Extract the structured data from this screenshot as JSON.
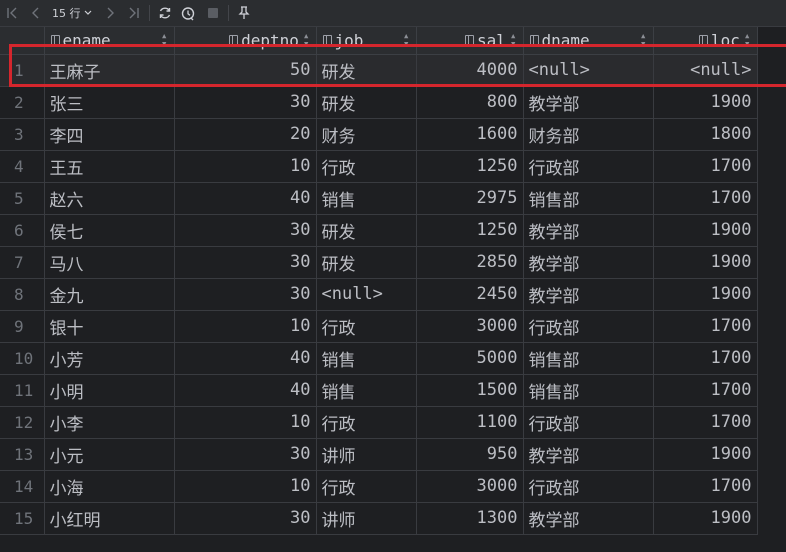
{
  "toolbar": {
    "rows_label": "15 行",
    "icons": [
      "first-page-icon",
      "prev-page-icon",
      "next-page-icon",
      "last-page-icon",
      "refresh-icon",
      "history-icon",
      "stop-icon",
      "pin-icon"
    ]
  },
  "columns": [
    "ename",
    "deptno",
    "job",
    "sal",
    "dname",
    "loc"
  ],
  "rows": [
    {
      "n": "1",
      "ename": "王麻子",
      "deptno": "50",
      "job": "研发",
      "sal": "4000",
      "dname": "<null>",
      "loc": "<null>"
    },
    {
      "n": "2",
      "ename": "张三",
      "deptno": "30",
      "job": "研发",
      "sal": "800",
      "dname": "教学部",
      "loc": "1900"
    },
    {
      "n": "3",
      "ename": "李四",
      "deptno": "20",
      "job": "财务",
      "sal": "1600",
      "dname": "财务部",
      "loc": "1800"
    },
    {
      "n": "4",
      "ename": "王五",
      "deptno": "10",
      "job": "行政",
      "sal": "1250",
      "dname": "行政部",
      "loc": "1700"
    },
    {
      "n": "5",
      "ename": "赵六",
      "deptno": "40",
      "job": "销售",
      "sal": "2975",
      "dname": "销售部",
      "loc": "1700"
    },
    {
      "n": "6",
      "ename": "侯七",
      "deptno": "30",
      "job": "研发",
      "sal": "1250",
      "dname": "教学部",
      "loc": "1900"
    },
    {
      "n": "7",
      "ename": "马八",
      "deptno": "30",
      "job": "研发",
      "sal": "2850",
      "dname": "教学部",
      "loc": "1900"
    },
    {
      "n": "8",
      "ename": "金九",
      "deptno": "30",
      "job": "<null>",
      "sal": "2450",
      "dname": "教学部",
      "loc": "1900"
    },
    {
      "n": "9",
      "ename": "银十",
      "deptno": "10",
      "job": "行政",
      "sal": "3000",
      "dname": "行政部",
      "loc": "1700"
    },
    {
      "n": "10",
      "ename": "小芳",
      "deptno": "40",
      "job": "销售",
      "sal": "5000",
      "dname": "销售部",
      "loc": "1700"
    },
    {
      "n": "11",
      "ename": "小明",
      "deptno": "40",
      "job": "销售",
      "sal": "1500",
      "dname": "销售部",
      "loc": "1700"
    },
    {
      "n": "12",
      "ename": "小李",
      "deptno": "10",
      "job": "行政",
      "sal": "1100",
      "dname": "行政部",
      "loc": "1700"
    },
    {
      "n": "13",
      "ename": "小元",
      "deptno": "30",
      "job": "讲师",
      "sal": "950",
      "dname": "教学部",
      "loc": "1900"
    },
    {
      "n": "14",
      "ename": "小海",
      "deptno": "10",
      "job": "行政",
      "sal": "3000",
      "dname": "行政部",
      "loc": "1700"
    },
    {
      "n": "15",
      "ename": "小红明",
      "deptno": "30",
      "job": "讲师",
      "sal": "1300",
      "dname": "教学部",
      "loc": "1900"
    }
  ]
}
